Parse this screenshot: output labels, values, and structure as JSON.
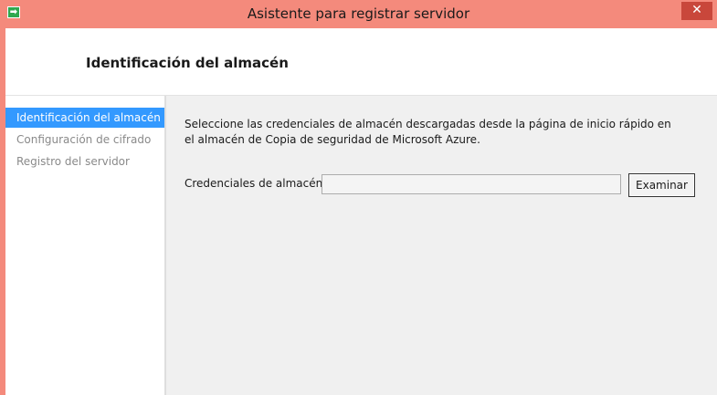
{
  "window": {
    "title": "Asistente para registrar servidor",
    "close_symbol": "✕",
    "app_icon_symbol": "➡",
    "app_icon_name": "arrow-right-icon"
  },
  "header": {
    "title": "Identificación del almacén"
  },
  "sidebar": {
    "items": [
      {
        "label": "Identificación del almacén",
        "active": true
      },
      {
        "label": "Configuración de cifrado",
        "active": false
      },
      {
        "label": "Registro del servidor",
        "active": false
      }
    ]
  },
  "main": {
    "description": "Seleccione las credenciales de almacén descargadas desde la página de inicio rápido en el almacén de Copia de seguridad de Microsoft Azure.",
    "credentials_label": "Credenciales de almacén:",
    "credentials_value": "",
    "browse_label": "Examinar"
  },
  "colors": {
    "titlebar": "#f48a7c",
    "close_button": "#c9473b",
    "selection": "#3399ff",
    "disabled_text": "#8a8a8a"
  }
}
